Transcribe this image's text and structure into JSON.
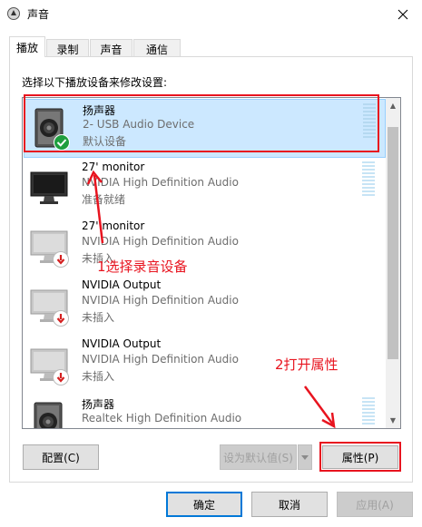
{
  "window": {
    "title": "声音"
  },
  "tabs": [
    {
      "label": "播放",
      "active": true
    },
    {
      "label": "录制",
      "active": false
    },
    {
      "label": "声音",
      "active": false
    },
    {
      "label": "通信",
      "active": false
    }
  ],
  "instruction": "选择以下播放设备来修改设置:",
  "devices": [
    {
      "name": "扬声器",
      "desc": "2- USB Audio Device",
      "status": "默认设备",
      "icon": "speaker-icon",
      "badge": "check-icon",
      "selected": true
    },
    {
      "name": "27' monitor",
      "desc": "NVIDIA High Definition Audio",
      "status": "准备就绪",
      "icon": "monitor-icon",
      "badge": "",
      "selected": false
    },
    {
      "name": "27' monitor",
      "desc": "NVIDIA High Definition Audio",
      "status": "未插入",
      "icon": "monitor-icon",
      "badge": "unplugged-icon",
      "selected": false
    },
    {
      "name": "NVIDIA Output",
      "desc": "NVIDIA High Definition Audio",
      "status": "未插入",
      "icon": "monitor-icon",
      "badge": "unplugged-icon",
      "selected": false
    },
    {
      "name": "NVIDIA Output",
      "desc": "NVIDIA High Definition Audio",
      "status": "未插入",
      "icon": "monitor-icon",
      "badge": "unplugged-icon",
      "selected": false
    },
    {
      "name": "扬声器",
      "desc": "Realtek High Definition Audio",
      "status": "",
      "icon": "speaker-icon",
      "badge": "",
      "selected": false
    }
  ],
  "buttons": {
    "configure": "配置(C)",
    "set_default": "设为默认值(S)",
    "properties": "属性(P)",
    "ok": "确定",
    "cancel": "取消",
    "apply": "应用(A)"
  },
  "annotations": {
    "step1": "1选择录音设备",
    "step2": "2打开属性"
  },
  "colors": {
    "selection": "#cce8ff",
    "annotation": "#e8141f",
    "default_button_border": "#0078d7"
  }
}
